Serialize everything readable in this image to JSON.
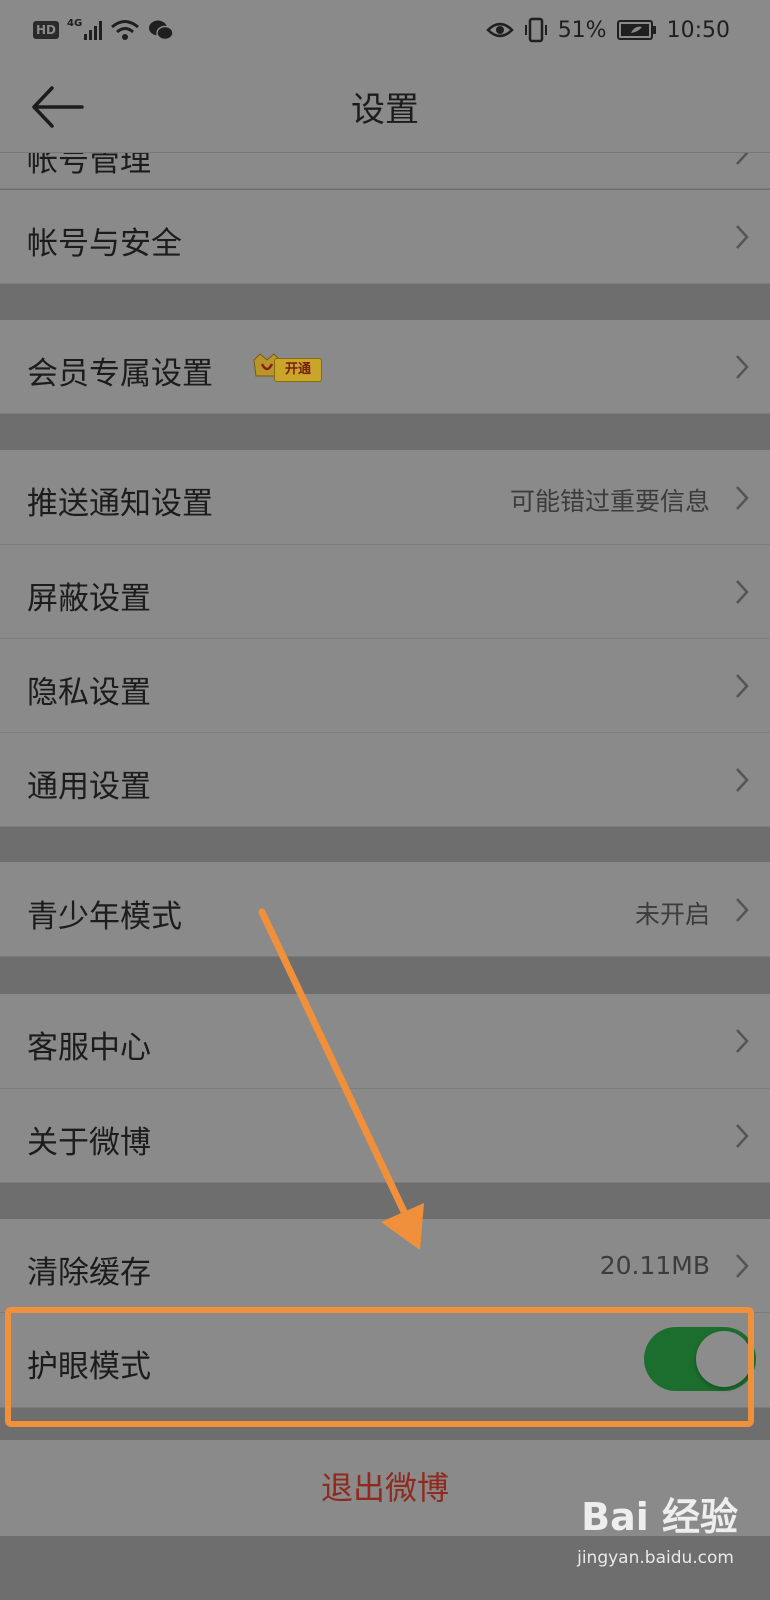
{
  "status_bar": {
    "network": "4G",
    "battery": "51%",
    "time": "10:50",
    "icons": [
      "hd-icon",
      "signal-icon",
      "wifi-icon",
      "wechat-icon",
      "eye-icon",
      "vibrate-icon",
      "battery-icon"
    ]
  },
  "header": {
    "title": "设置",
    "back_icon": "back-arrow-icon"
  },
  "rows": {
    "account_manage": {
      "label": "帐号管理"
    },
    "account_security": {
      "label": "帐号与安全"
    },
    "vip": {
      "label": "会员专属设置",
      "badge": "开通"
    },
    "push": {
      "label": "推送通知设置",
      "value": "可能错过重要信息"
    },
    "block": {
      "label": "屏蔽设置"
    },
    "privacy": {
      "label": "隐私设置"
    },
    "general": {
      "label": "通用设置"
    },
    "youth": {
      "label": "青少年模式",
      "value": "未开启"
    },
    "service": {
      "label": "客服中心"
    },
    "about": {
      "label": "关于微博"
    },
    "cache": {
      "label": "清除缓存",
      "value": "20.11MB"
    },
    "eye_care": {
      "label": "护眼模式",
      "toggle_on": true
    }
  },
  "logout": {
    "label": "退出微博"
  },
  "watermark": {
    "main": "Bai 经验",
    "sub": "jingyan.baidu.com"
  },
  "colors": {
    "annotation": "#f0903a",
    "toggle_on": "#1c6e2e",
    "logout_text": "#8f2a20"
  }
}
